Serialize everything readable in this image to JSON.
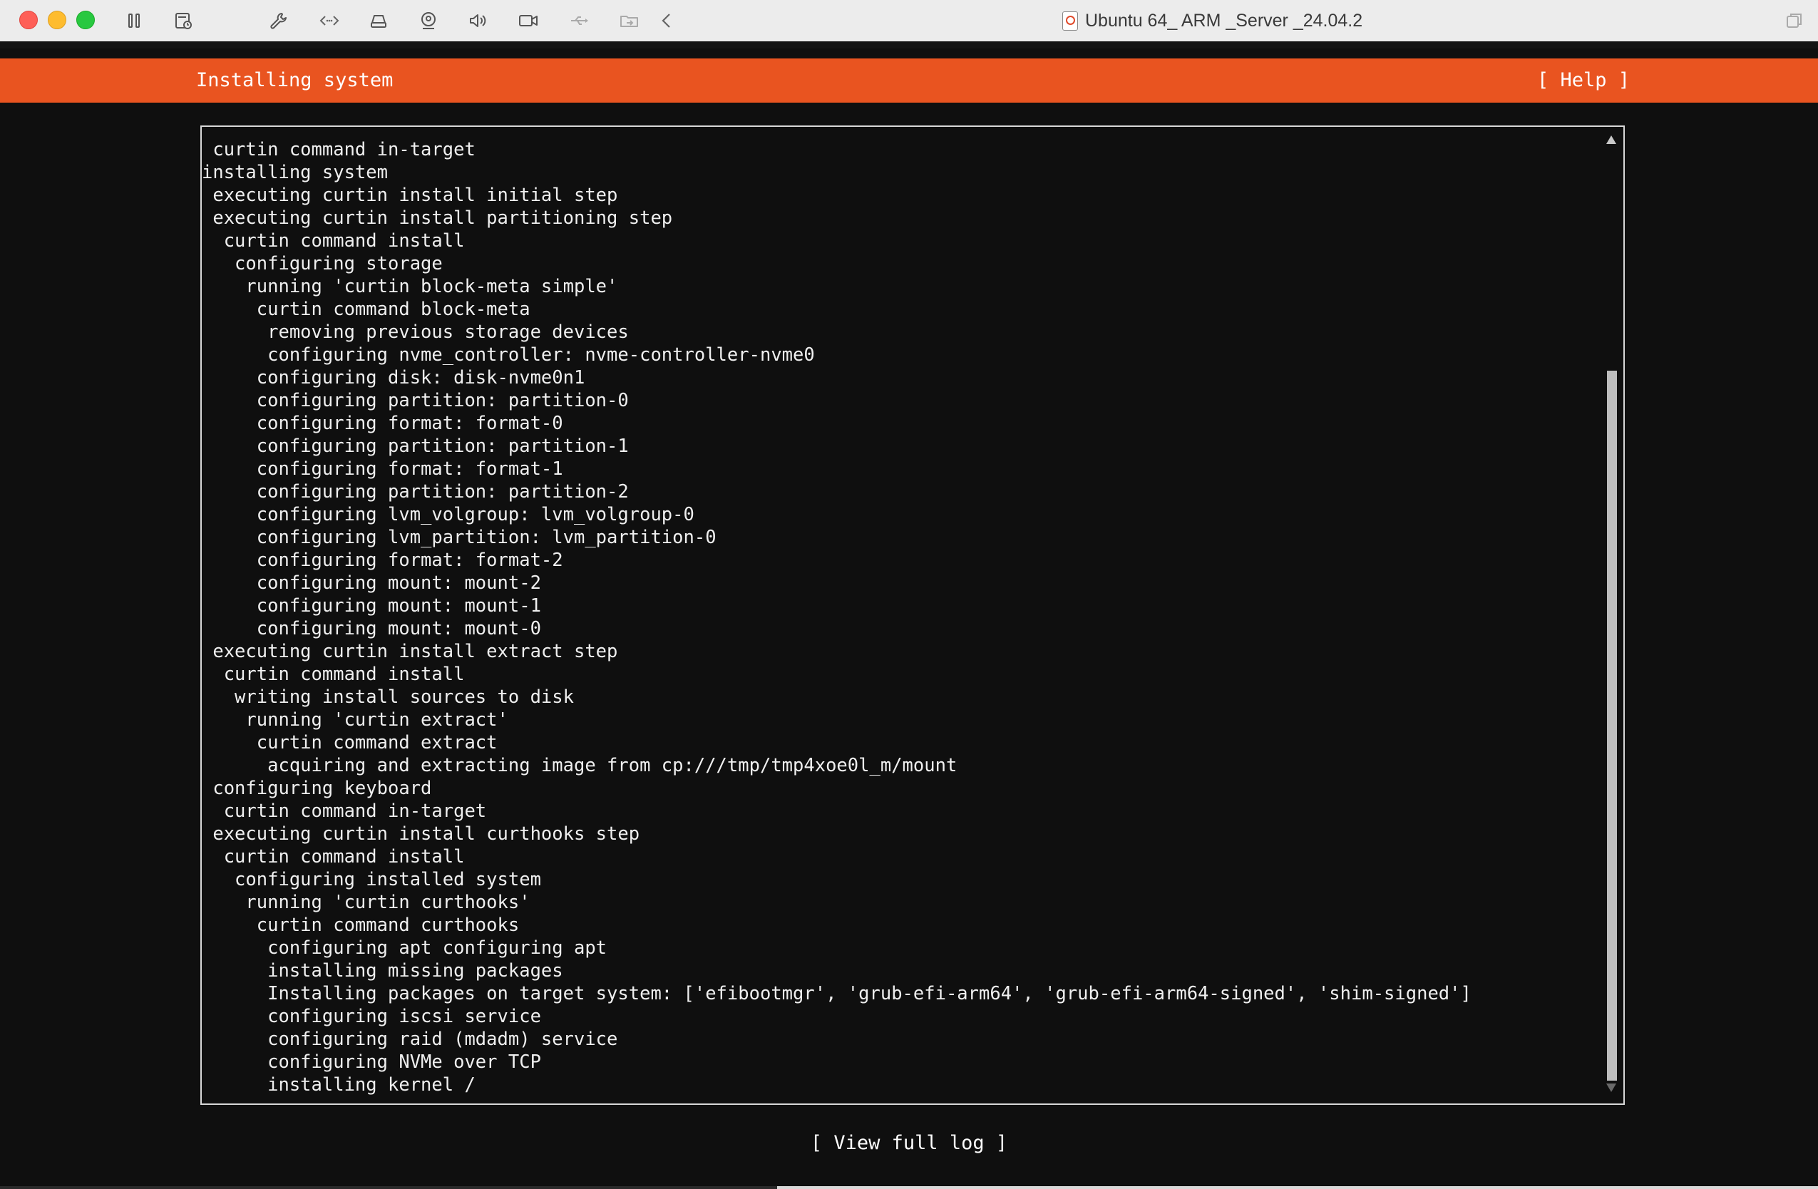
{
  "window": {
    "title": "Ubuntu 64_ ARM _Server _24.04.2"
  },
  "toolbar": {
    "icons": [
      "pause-icon",
      "snapshot-icon",
      "settings-wrench-icon",
      "code-icon",
      "hard-disk-icon",
      "camera-icon",
      "sound-icon",
      "video-icon",
      "usb-icon",
      "shared-folder-icon",
      "back-chevron-icon"
    ]
  },
  "installer": {
    "title": "Installing system",
    "help_label": "[ Help ]",
    "view_log_label": "[ View full log ]",
    "accent_color": "#e95420",
    "log_lines": [
      " curtin command in-target",
      "installing system",
      " executing curtin install initial step",
      " executing curtin install partitioning step",
      "  curtin command install",
      "   configuring storage",
      "    running 'curtin block-meta simple'",
      "     curtin command block-meta",
      "      removing previous storage devices",
      "      configuring nvme_controller: nvme-controller-nvme0",
      "     configuring disk: disk-nvme0n1",
      "     configuring partition: partition-0",
      "     configuring format: format-0",
      "     configuring partition: partition-1",
      "     configuring format: format-1",
      "     configuring partition: partition-2",
      "     configuring lvm_volgroup: lvm_volgroup-0",
      "     configuring lvm_partition: lvm_partition-0",
      "     configuring format: format-2",
      "     configuring mount: mount-2",
      "     configuring mount: mount-1",
      "     configuring mount: mount-0",
      " executing curtin install extract step",
      "  curtin command install",
      "   writing install sources to disk",
      "    running 'curtin extract'",
      "     curtin command extract",
      "      acquiring and extracting image from cp:///tmp/tmp4xoe0l_m/mount",
      " configuring keyboard",
      "  curtin command in-target",
      " executing curtin install curthooks step",
      "  curtin command install",
      "   configuring installed system",
      "    running 'curtin curthooks'",
      "     curtin command curthooks",
      "      configuring apt configuring apt",
      "      installing missing packages",
      "      Installing packages on target system: ['efibootmgr', 'grub-efi-arm64', 'grub-efi-arm64-signed', 'shim-signed']",
      "      configuring iscsi service",
      "      configuring raid (mdadm) service",
      "      configuring NVMe over TCP",
      "      installing kernel /"
    ]
  }
}
